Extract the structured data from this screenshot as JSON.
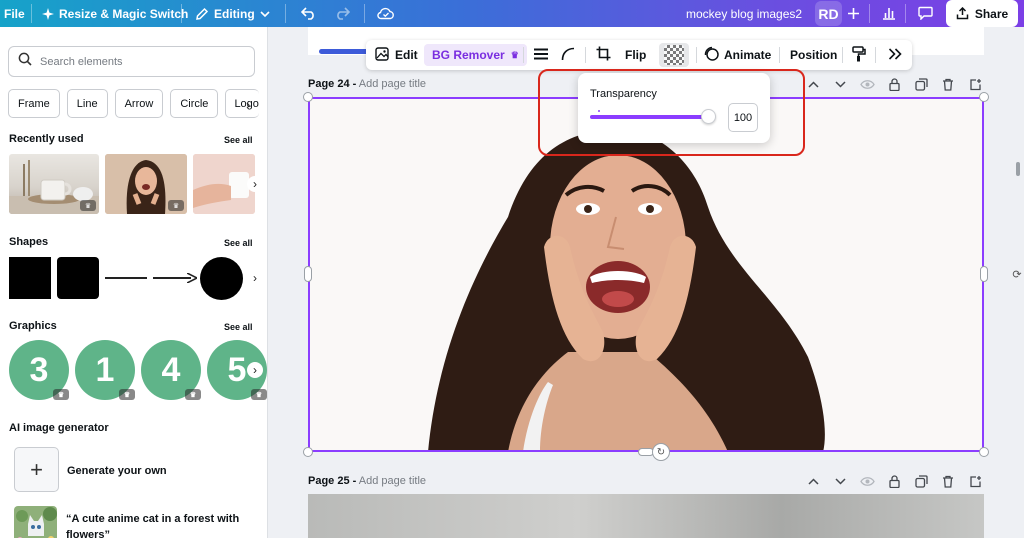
{
  "topbar": {
    "file_label": "File",
    "resize_label": "Resize & Magic Switch",
    "editing_label": "Editing",
    "doc_title": "mockey blog images2",
    "avatar_initials": "RD",
    "share_label": "Share",
    "gradient_colors": [
      "#16a3c9",
      "#3a6fd8",
      "#6a4fe0",
      "#7b3fe6"
    ]
  },
  "left_panel": {
    "search_placeholder": "Search elements",
    "chips": [
      "Frame",
      "Line",
      "Arrow",
      "Circle",
      "Logo"
    ],
    "recently_used": {
      "title": "Recently used",
      "see_all": "See all"
    },
    "shapes": {
      "title": "Shapes",
      "see_all": "See all"
    },
    "graphics": {
      "title": "Graphics",
      "see_all": "See all",
      "numbers": [
        "3",
        "1",
        "4",
        "5"
      ],
      "color": "#5fb489"
    },
    "ai_generator": {
      "title": "AI image generator",
      "generate_label": "Generate your own",
      "prompt": "“A cute anime cat in a forest with flowers”"
    }
  },
  "toolbar": {
    "edit_label": "Edit",
    "bg_remover_label": "BG Remover",
    "flip_label": "Flip",
    "animate_label": "Animate",
    "position_label": "Position"
  },
  "popover": {
    "title": "Transparency",
    "value": "100",
    "slider_fraction": 1.0,
    "accent_color": "#8b3dff"
  },
  "pages": [
    {
      "number": "Page 24 -",
      "title_placeholder": "Add page title"
    },
    {
      "number": "Page 25 -",
      "title_placeholder": "Add page title"
    }
  ],
  "colors": {
    "selection": "#8b3dff",
    "highlight": "#d9271c"
  }
}
